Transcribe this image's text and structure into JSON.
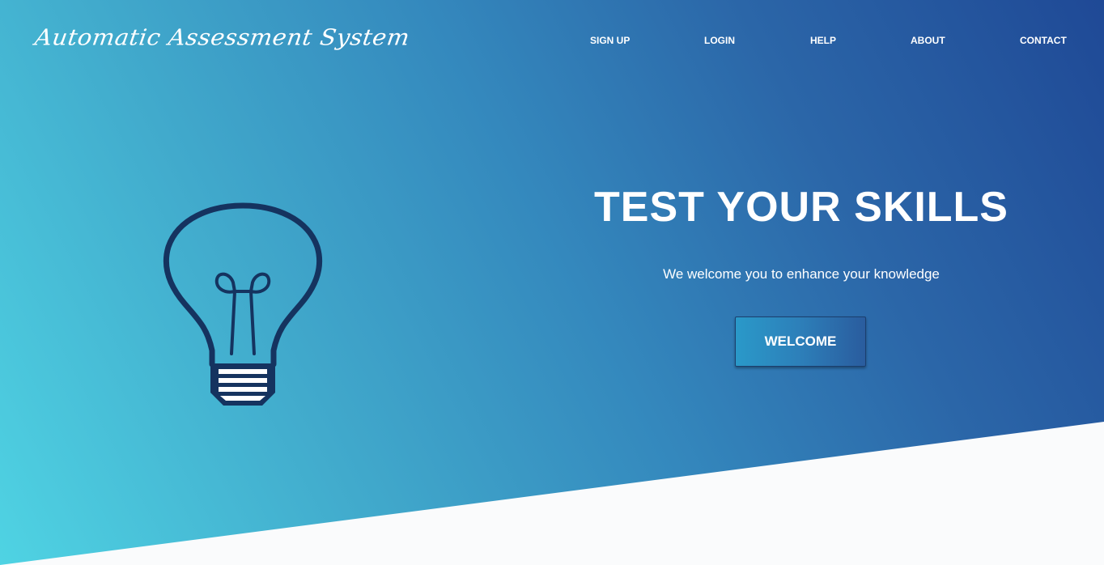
{
  "header": {
    "logo_text": "Automatic Assessment System",
    "nav": [
      {
        "label": "SIGN UP"
      },
      {
        "label": "LOGIN"
      },
      {
        "label": "HELP"
      },
      {
        "label": "ABOUT"
      },
      {
        "label": "CONTACT"
      }
    ]
  },
  "hero": {
    "title": "TEST YOUR SKILLS",
    "subtitle": "We welcome you to enhance your knowledge",
    "button_label": "WELCOME",
    "illustration": "lightbulb-icon"
  },
  "colors": {
    "gradient_start": "#4fd3e3",
    "gradient_end": "#1f4996",
    "bulb_stroke": "#15335f",
    "text": "#ffffff",
    "bottom_band": "#fafbfc"
  }
}
